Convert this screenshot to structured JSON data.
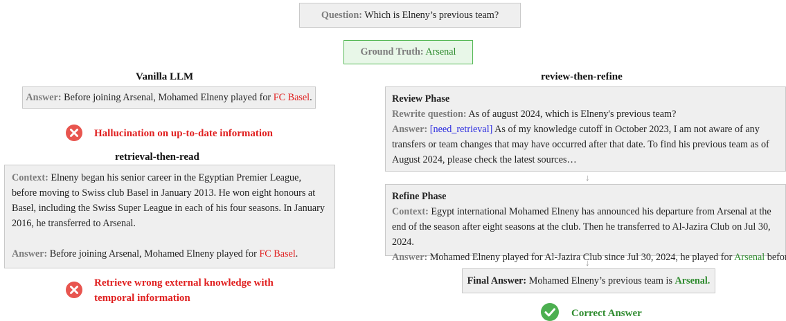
{
  "question": {
    "label": "Question:",
    "text": "Which is Elneny’s previous team?"
  },
  "ground_truth": {
    "label": "Ground Truth:",
    "text": "Arsenal"
  },
  "vanilla": {
    "header": "Vanilla LLM",
    "answer_label": "Answer:",
    "answer_text": "Before joining Arsenal, Mohamed Elneny played for",
    "answer_team": "FC Basel",
    "answer_end": ".",
    "error": "Hallucination on up-to-date information",
    "error_icon": "error-x-icon"
  },
  "rtr": {
    "header": "retrieval-then-read",
    "context_label": "Context:",
    "context_text": "Elneny began his senior career in the Egyptian Premier League, before moving to Swiss club Basel in January 2013. He won eight honours at Basel, including the Swiss Super League in each of his four seasons. In January 2016, he transferred to Arsenal.",
    "answer_label": "Answer:",
    "answer_text": "Before joining Arsenal, Mohamed Elneny played for",
    "answer_team": "FC Basel",
    "answer_end": ".",
    "error_line1": "Retrieve wrong external knowledge with",
    "error_line2": "temporal information",
    "error_icon": "error-x-icon"
  },
  "rtr_refine": {
    "header": "review-then-refine",
    "review": {
      "title": "Review Phase",
      "rewrite_label": "Rewrite question:",
      "rewrite_text": "As of august 2024, which is Elneny's previous team?",
      "answer_label": "Answer:",
      "answer_tag": "[need_retrieval]",
      "answer_text": "As of my knowledge cutoff in October 2023,  I am not aware of any transfers or team changes that may have occurred after that date. To find his previous team as of August 2024, please check the latest sources…"
    },
    "refine": {
      "title": "Refine Phase",
      "context_label": "Context:",
      "context_text": "Egypt international Mohamed Elneny has announced his departure from Arsenal at the end of the season after eight seasons at the club. Then he transferred to Al-Jazira Club on Jul 30, 2024.",
      "answer_label": "Answer:",
      "answer_text": "Mohamed Elneny played for Al-Jazira Club since Jul 30, 2024, he played for",
      "answer_team": "Arsenal",
      "answer_end": "before…"
    },
    "final": {
      "label": "Final Answer:",
      "text": "Mohamed Elneny’s previous team is",
      "team": "Arsenal."
    },
    "correct": "Correct Answer",
    "correct_icon": "check-circle-icon",
    "arrow_icon": "down-arrow-icon"
  },
  "colors": {
    "error": "#e02020",
    "correct": "#2e8b2e",
    "tag": "#2a2adf",
    "box": "#efefef"
  }
}
